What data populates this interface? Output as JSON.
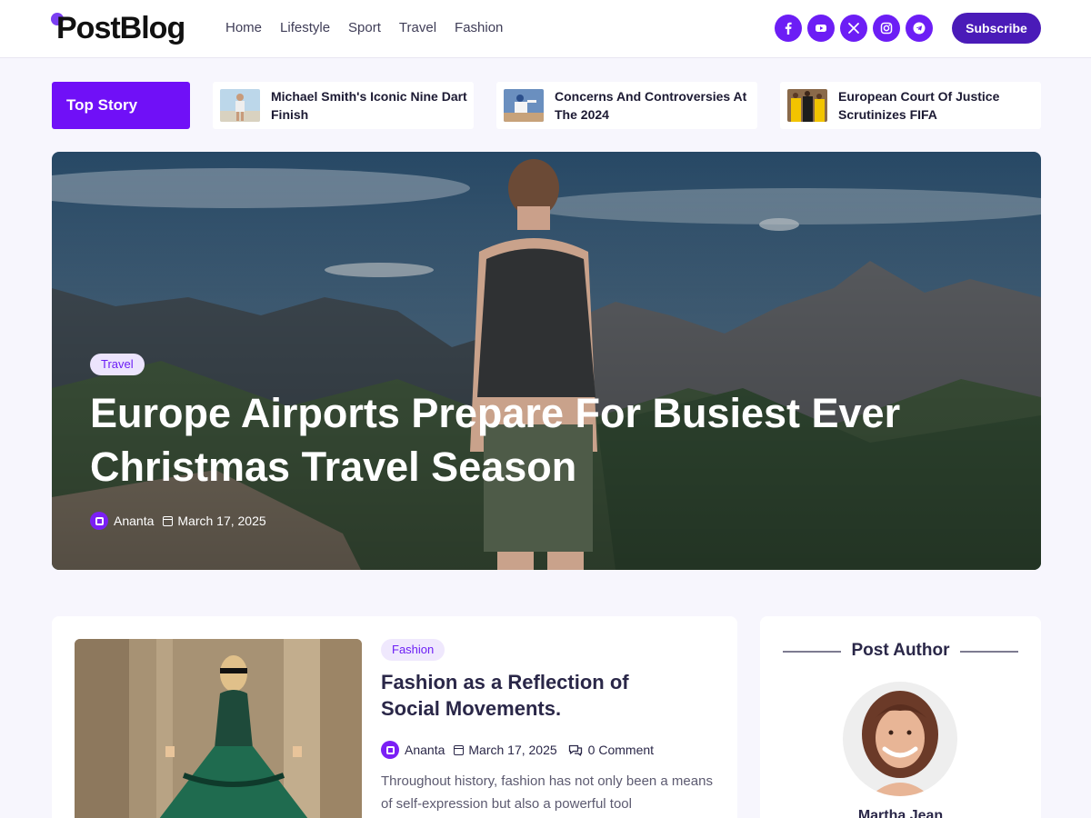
{
  "brand": {
    "logo": "PostBlog",
    "accent": "#6c1ef5"
  },
  "nav": [
    "Home",
    "Lifestyle",
    "Sport",
    "Travel",
    "Fashion"
  ],
  "socials": [
    "facebook-icon",
    "youtube-icon",
    "x-icon",
    "instagram-icon",
    "telegram-icon"
  ],
  "subscribe_label": "Subscribe",
  "top_story": {
    "label": "Top Story",
    "items": [
      {
        "title": "Michael Smith's Iconic Nine Dart Finish"
      },
      {
        "title": "Concerns And Controversies At The 2024"
      },
      {
        "title": "European Court Of Justice Scrutinizes FIFA"
      }
    ]
  },
  "hero": {
    "category": "Travel",
    "title": "Europe Airports Prepare For Busiest Ever Christmas Travel Season",
    "author": "Ananta",
    "date": "March 17, 2025"
  },
  "post": {
    "category": "Fashion",
    "title": "Fashion as a Reflection of Social Movements.",
    "author": "Ananta",
    "date": "March 17, 2025",
    "comments": "0 Comment",
    "excerpt": "Throughout history, fashion has not only been a means of self-expression but also a powerful tool"
  },
  "sidebar": {
    "title": "Post Author",
    "author_name": "Martha Jean"
  }
}
